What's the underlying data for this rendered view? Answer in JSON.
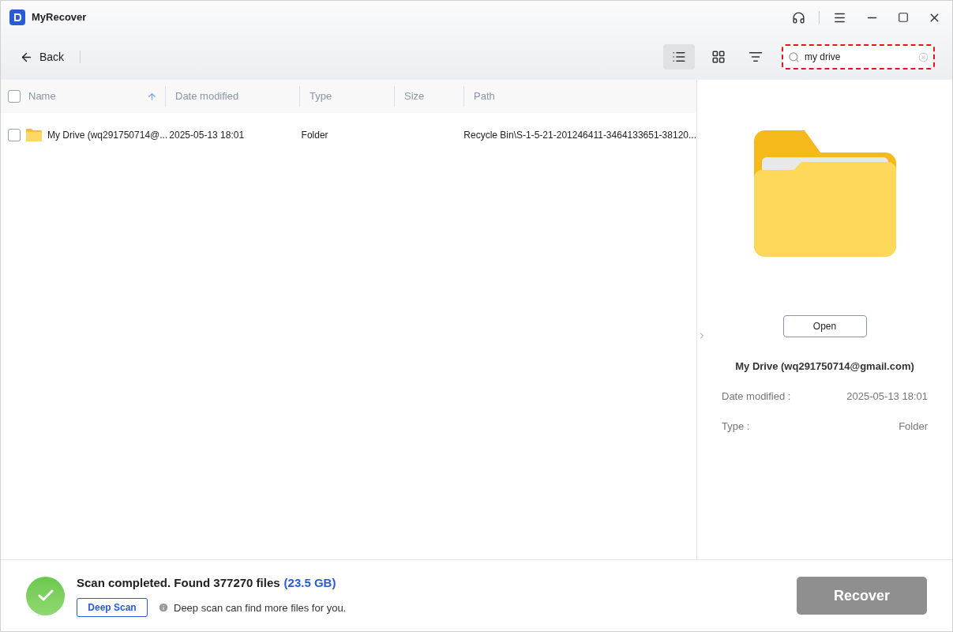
{
  "window": {
    "title": "MyRecover"
  },
  "toolbar": {
    "back": "Back",
    "views": [
      {
        "kind": "list",
        "selected": true
      },
      {
        "kind": "grid",
        "selected": false
      }
    ],
    "search": {
      "value": "my drive"
    }
  },
  "table": {
    "all_checked": false,
    "columns": [
      {
        "label": "Name",
        "sorted": true
      },
      {
        "label": "Date modified",
        "sorted": false
      },
      {
        "label": "Type",
        "sorted": false
      },
      {
        "label": "Size",
        "sorted": false
      },
      {
        "label": "Path",
        "sorted": false
      }
    ],
    "rows": [
      {
        "checked": false,
        "name": "My Drive (wq291750714@...",
        "date": "2025-05-13 18:01",
        "type": "Folder",
        "size": "",
        "path": "Recycle Bin\\S-1-5-21-201246411-3464133651-38120..."
      }
    ]
  },
  "preview": {
    "open": "Open",
    "title": "My Drive (wq291750714@gmail.com)",
    "fields": [
      {
        "label": "Date modified :",
        "value": "2025-05-13 18:01"
      },
      {
        "label": "Type :",
        "value": "Folder"
      }
    ]
  },
  "status": {
    "message": "Scan completed. Found 377270 files",
    "size": "(23.5 GB)",
    "deep_scan": "Deep Scan",
    "hint": "Deep scan can find more files for you.",
    "recover": "Recover",
    "recover_disabled": true
  }
}
